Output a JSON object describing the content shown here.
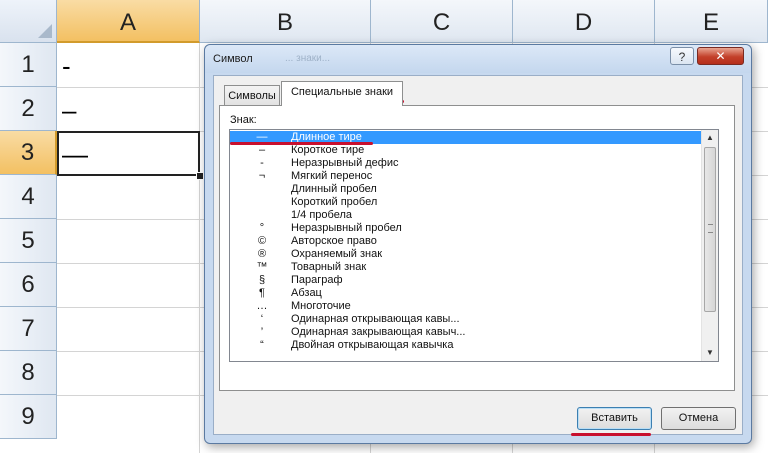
{
  "spreadsheet": {
    "columns": [
      "A",
      "B",
      "C",
      "D",
      "E"
    ],
    "rows": [
      "1",
      "2",
      "3",
      "4",
      "5",
      "6",
      "7",
      "8",
      "9"
    ],
    "cells": {
      "a1": "-",
      "a2": "–",
      "a3": "—"
    },
    "active_cell": "A3"
  },
  "dialog": {
    "title": "Символ",
    "ghost_title": "... знаки...",
    "help_label": "?",
    "close_label": "✕",
    "tabs": [
      {
        "label": "Символы",
        "active": false
      },
      {
        "label": "Специальные знаки",
        "active": true
      }
    ],
    "list_label": "Знак:",
    "items": [
      {
        "symbol": "—",
        "name": "Длинное тире",
        "selected": true
      },
      {
        "symbol": "–",
        "name": "Короткое тире",
        "selected": false
      },
      {
        "symbol": "‑",
        "name": "Неразрывный дефис",
        "selected": false
      },
      {
        "symbol": "¬",
        "name": "Мягкий перенос",
        "selected": false
      },
      {
        "symbol": "",
        "name": "Длинный пробел",
        "selected": false
      },
      {
        "symbol": "",
        "name": "Короткий пробел",
        "selected": false
      },
      {
        "symbol": "",
        "name": "1/4 пробела",
        "selected": false
      },
      {
        "symbol": "°",
        "name": "Неразрывный пробел",
        "selected": false
      },
      {
        "symbol": "©",
        "name": "Авторское право",
        "selected": false
      },
      {
        "symbol": "®",
        "name": "Охраняемый знак",
        "selected": false
      },
      {
        "symbol": "™",
        "name": "Товарный знак",
        "selected": false
      },
      {
        "symbol": "§",
        "name": "Параграф",
        "selected": false
      },
      {
        "symbol": "¶",
        "name": "Абзац",
        "selected": false
      },
      {
        "symbol": "…",
        "name": "Многоточие",
        "selected": false
      },
      {
        "symbol": "‘",
        "name": "Одинарная открывающая кавы...",
        "selected": false
      },
      {
        "symbol": "’",
        "name": "Одинарная закрывающая кавыч...",
        "selected": false
      },
      {
        "symbol": "“",
        "name": "Двойная открывающая кавычка",
        "selected": false
      }
    ],
    "scroll_up_icon": "▲",
    "scroll_down_icon": "▼",
    "insert_label": "Вставить",
    "cancel_label": "Отмена"
  },
  "colors": {
    "selection": "#3399ff",
    "annotation_red": "#c8102e",
    "header_selected": "#f3c062"
  }
}
